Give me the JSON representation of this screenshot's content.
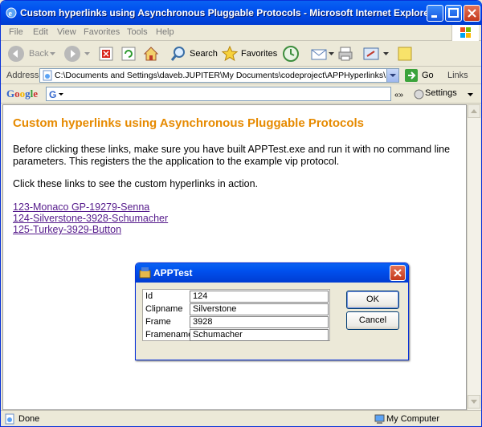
{
  "window": {
    "title": "Custom hyperlinks using Asynchronous Pluggable Protocols - Microsoft Internet Explorer"
  },
  "menu": [
    "File",
    "Edit",
    "View",
    "Favorites",
    "Tools",
    "Help"
  ],
  "toolbar": {
    "back_label": "Back",
    "search_label": "Search",
    "favorites_label": "Favorites"
  },
  "address": {
    "label": "Address",
    "value": "C:\\Documents and Settings\\daveb.JUPITER\\My Documents\\codeproject\\APPHyperlinks\\APPTest.h",
    "go_label": "Go",
    "links_label": "Links"
  },
  "google": {
    "logo": "Google",
    "settings_label": "Settings"
  },
  "page": {
    "heading": "Custom hyperlinks using Asynchronous Pluggable Protocols",
    "para1": "Before clicking these links, make sure you have built APPTest.exe and run it with no command line parameters. This registers the the application to the example vip protocol.",
    "para2": "Click these links to see the custom hyperlinks in action.",
    "links": [
      "123-Monaco GP-19279-Senna",
      "124-Silverstone-3928-Schumacher",
      "125-Turkey-3929-Button"
    ]
  },
  "dialog": {
    "title": "APPTest",
    "fields": [
      {
        "label": "Id",
        "value": "124"
      },
      {
        "label": "Clipname",
        "value": "Silverstone"
      },
      {
        "label": "Frame",
        "value": "3928"
      },
      {
        "label": "Framename",
        "value": "Schumacher"
      }
    ],
    "ok_label": "OK",
    "cancel_label": "Cancel"
  },
  "status": {
    "text": "Done",
    "zone": "My Computer"
  },
  "colors": {
    "titlebar": "#0050EE",
    "heading": "#E68A00",
    "link": "#551A8B"
  }
}
